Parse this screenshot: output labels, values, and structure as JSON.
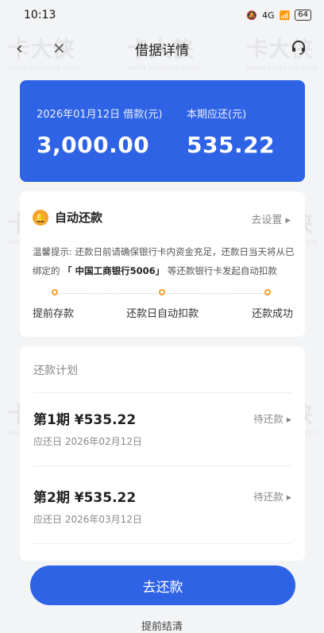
{
  "status_bar": {
    "time": "10:13",
    "signal": "4G",
    "battery": "64"
  },
  "nav": {
    "title": "借据详情"
  },
  "loan": {
    "date_label": "2026年01月12日 借款(元)",
    "amount": "3,000.00",
    "due_label": "本期应还(元)",
    "due_amount": "535.22"
  },
  "auto_repay": {
    "title": "自动还款",
    "settings_link": "去设置",
    "tip_prefix": "温馨提示: 还款日前请确保银行卡内资金充足，还款日当天将从已绑定的",
    "bank": "「 中国工商银行5006」",
    "tip_suffix": "等还款银行卡发起自动扣款",
    "steps": [
      "提前存款",
      "还款日自动扣款",
      "还款成功"
    ]
  },
  "plan": {
    "title": "还款计划",
    "installments": [
      {
        "period": "第1期",
        "amount": "¥535.22",
        "status": "待还款",
        "due": "应还日 2026年02月12日"
      },
      {
        "period": "第2期",
        "amount": "¥535.22",
        "status": "待还款",
        "due": "应还日 2026年03月12日"
      }
    ]
  },
  "actions": {
    "pay": "去还款",
    "early": "提前结清"
  },
  "watermark": {
    "brand": "卡大侠",
    "url": "www.kadaxia.com"
  },
  "colors": {
    "primary": "#2f63e6",
    "accent": "#f39c2b"
  },
  "icons": [
    "back-icon",
    "close-icon",
    "headset-icon",
    "bell-icon",
    "chevron-right-icon"
  ]
}
